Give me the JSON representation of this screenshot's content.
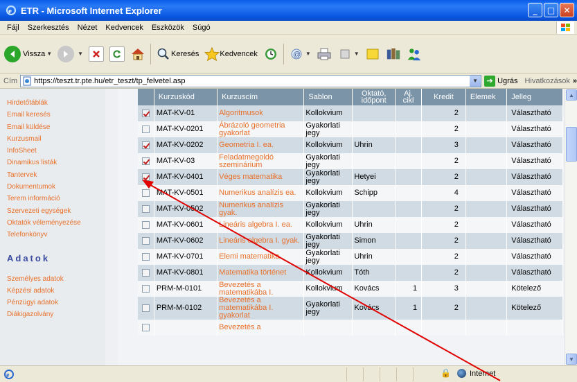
{
  "window": {
    "title": "ETR - Microsoft Internet Explorer",
    "minimize": "_",
    "maximize": "□",
    "close": "✕"
  },
  "menu": [
    "Fájl",
    "Szerkesztés",
    "Nézet",
    "Kedvencek",
    "Eszközök",
    "Súgó"
  ],
  "toolbar": {
    "back": "Vissza",
    "search": "Keresés",
    "favorites": "Kedvencek"
  },
  "address": {
    "label": "Cím",
    "url": "https://teszt.tr.pte.hu/etr_teszt/tp_felvetel.asp",
    "go": "Ugrás",
    "links": "Hivatkozások"
  },
  "sidebar": {
    "links1": [
      "Hirdetőtáblák",
      "Email keresés",
      "Email küldése",
      "Kurzusmail",
      "InfoSheet",
      "Dinamikus listák",
      "Tantervek",
      "Dokumentumok",
      "Terem információ",
      "Szervezeti egységek",
      "Oktatók véleményezése",
      "Telefonkönyv"
    ],
    "section_title": "Adatok",
    "links2": [
      "Személyes adatok",
      "Képzési adatok",
      "Pénzügyi adatok",
      "Diákigazolvány"
    ]
  },
  "table": {
    "headers": [
      "Kurzuskód",
      "Kurzuscím",
      "Sablon",
      "Oktató, időpont",
      "Aj. cikl",
      "Kredit",
      "Elemek",
      "Jelleg"
    ],
    "rows": [
      {
        "checked": true,
        "kod": "MAT-KV-01",
        "cim": "Algoritmusok",
        "sablon": "Kollokvium",
        "oktato": "",
        "aj": "",
        "kredit": "2",
        "elemek": "",
        "jelleg": "Választható"
      },
      {
        "checked": false,
        "kod": "MAT-KV-0201",
        "cim": "Ábrázoló geometria gyakorlat",
        "sablon": "Gyakorlati jegy",
        "oktato": "",
        "aj": "",
        "kredit": "2",
        "elemek": "",
        "jelleg": "Választható"
      },
      {
        "checked": true,
        "kod": "MAT-KV-0202",
        "cim": "Geometria I. ea.",
        "sablon": "Kollokvium",
        "oktato": "Uhrin",
        "aj": "",
        "kredit": "3",
        "elemek": "",
        "jelleg": "Választható"
      },
      {
        "checked": true,
        "kod": "MAT-KV-03",
        "cim": "Feladatmegoldó szeminárium",
        "sablon": "Gyakorlati jegy",
        "oktato": "",
        "aj": "",
        "kredit": "2",
        "elemek": "",
        "jelleg": "Választható"
      },
      {
        "checked": true,
        "kod": "MAT-KV-0401",
        "cim": "Véges matematika",
        "sablon": "Gyakorlati jegy",
        "oktato": "Hetyei",
        "aj": "",
        "kredit": "2",
        "elemek": "",
        "jelleg": "Választható"
      },
      {
        "checked": false,
        "kod": "MAT-KV-0501",
        "cim": "Numerikus analízis ea.",
        "sablon": "Kollokvium",
        "oktato": "Schipp",
        "aj": "",
        "kredit": "4",
        "elemek": "",
        "jelleg": "Választható"
      },
      {
        "checked": false,
        "kod": "MAT-KV-0502",
        "cim": "Numerikus analízis gyak.",
        "sablon": "Gyakorlati jegy",
        "oktato": "",
        "aj": "",
        "kredit": "2",
        "elemek": "",
        "jelleg": "Választható"
      },
      {
        "checked": false,
        "kod": "MAT-KV-0601",
        "cim": "Lineáris algebra I. ea.",
        "sablon": "Kollokvium",
        "oktato": "Uhrin",
        "aj": "",
        "kredit": "2",
        "elemek": "",
        "jelleg": "Választható"
      },
      {
        "checked": false,
        "kod": "MAT-KV-0602",
        "cim": "Lineáris algebra I. gyak.",
        "sablon": "Gyakorlati jegy",
        "oktato": "Simon",
        "aj": "",
        "kredit": "2",
        "elemek": "",
        "jelleg": "Választható"
      },
      {
        "checked": false,
        "kod": "MAT-KV-0701",
        "cim": "Elemi matematika",
        "sablon": "Gyakorlati jegy",
        "oktato": "Uhrin",
        "aj": "",
        "kredit": "2",
        "elemek": "",
        "jelleg": "Választható"
      },
      {
        "checked": false,
        "kod": "MAT-KV-0801",
        "cim": "Matematika történet",
        "sablon": "Kollokvium",
        "oktato": "Tóth",
        "aj": "",
        "kredit": "2",
        "elemek": "",
        "jelleg": "Választható"
      },
      {
        "checked": false,
        "kod": "PRM-M-0101",
        "cim": "Bevezetés a matematikába I.",
        "sablon": "Kollokvium",
        "oktato": "Kovács",
        "aj": "1",
        "kredit": "3",
        "elemek": "",
        "jelleg": "Kötelező"
      },
      {
        "checked": false,
        "kod": "PRM-M-0102",
        "cim": "Bevezetés a matematikába I. gyakorlat",
        "sablon": "Gyakorlati jegy",
        "oktato": "Kovács",
        "aj": "1",
        "kredit": "2",
        "elemek": "",
        "jelleg": "Kötelező"
      },
      {
        "checked": false,
        "kod": "",
        "cim": "Bevezetés a",
        "sablon": "",
        "oktato": "",
        "aj": "",
        "kredit": "",
        "elemek": "",
        "jelleg": ""
      }
    ]
  },
  "status": {
    "zone": "Internet"
  },
  "colors": {
    "link_orange": "#e8702a",
    "header_bg": "#7b94a8",
    "row_odd": "#d1dbe3",
    "annotation_arrow": "#e00000"
  }
}
